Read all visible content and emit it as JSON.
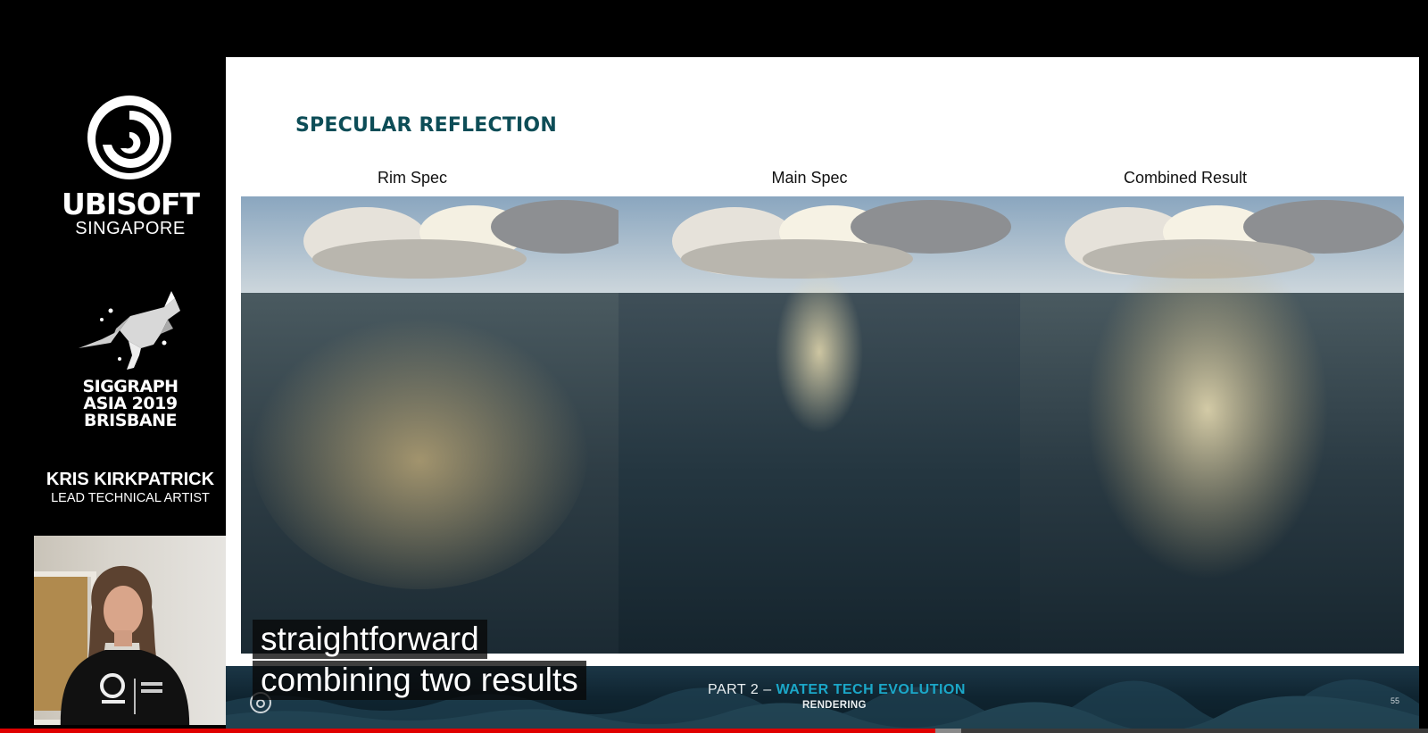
{
  "sidebar": {
    "company": "UBISOFT",
    "studio": "SINGAPORE",
    "conference_lines": [
      "SIGGRAPH",
      "ASIA 2019",
      "BRISBANE"
    ],
    "speaker_name": "KRIS KIRKPATRICK",
    "speaker_title": "LEAD TECHNICAL ARTIST"
  },
  "slide": {
    "title": "SPECULAR REFLECTION",
    "panels": [
      {
        "label": "Rim Spec"
      },
      {
        "label": "Main Spec"
      },
      {
        "label": "Combined Result"
      }
    ],
    "footer": {
      "part_prefix": "PART 2 –",
      "part_title": "WATER TECH EVOLUTION",
      "section": "RENDERING",
      "page_number": "55"
    }
  },
  "captions": {
    "line1": "straightforward",
    "line2": "combining two results"
  },
  "player": {
    "progress_fraction": 0.655,
    "buffered_fraction": 0.673
  },
  "icons": {
    "brand": "ubisoft-swirl-icon",
    "conference": "kangaroo-icon",
    "footer": "ubisoft-swirl-small-icon"
  }
}
